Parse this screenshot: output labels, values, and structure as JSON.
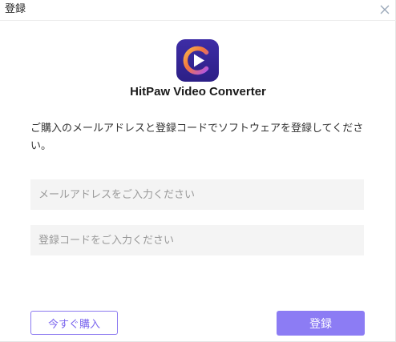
{
  "window": {
    "title": "登録",
    "close_icon": "close-icon"
  },
  "app": {
    "name": "HitPaw Video Converter",
    "logo_icon": "hitpaw-video-converter-logo-icon"
  },
  "instruction": "ご購入のメールアドレスと登録コードでソフトウェアを登録してください。",
  "form": {
    "email_placeholder": "メールアドレスをご入力ください",
    "email_value": "",
    "code_placeholder": "登録コードをご入力ください",
    "code_value": ""
  },
  "buttons": {
    "buy_label": "今すぐ購入",
    "register_label": "登録"
  },
  "colors": {
    "accent": "#8c7cf4",
    "accent_text": "#7b66ee",
    "logo_bg": "#3b2a9e",
    "logo_ring_orange": "#f39a3d",
    "logo_ring_purple": "#9b6cff",
    "input_bg": "#f4f4f4"
  }
}
